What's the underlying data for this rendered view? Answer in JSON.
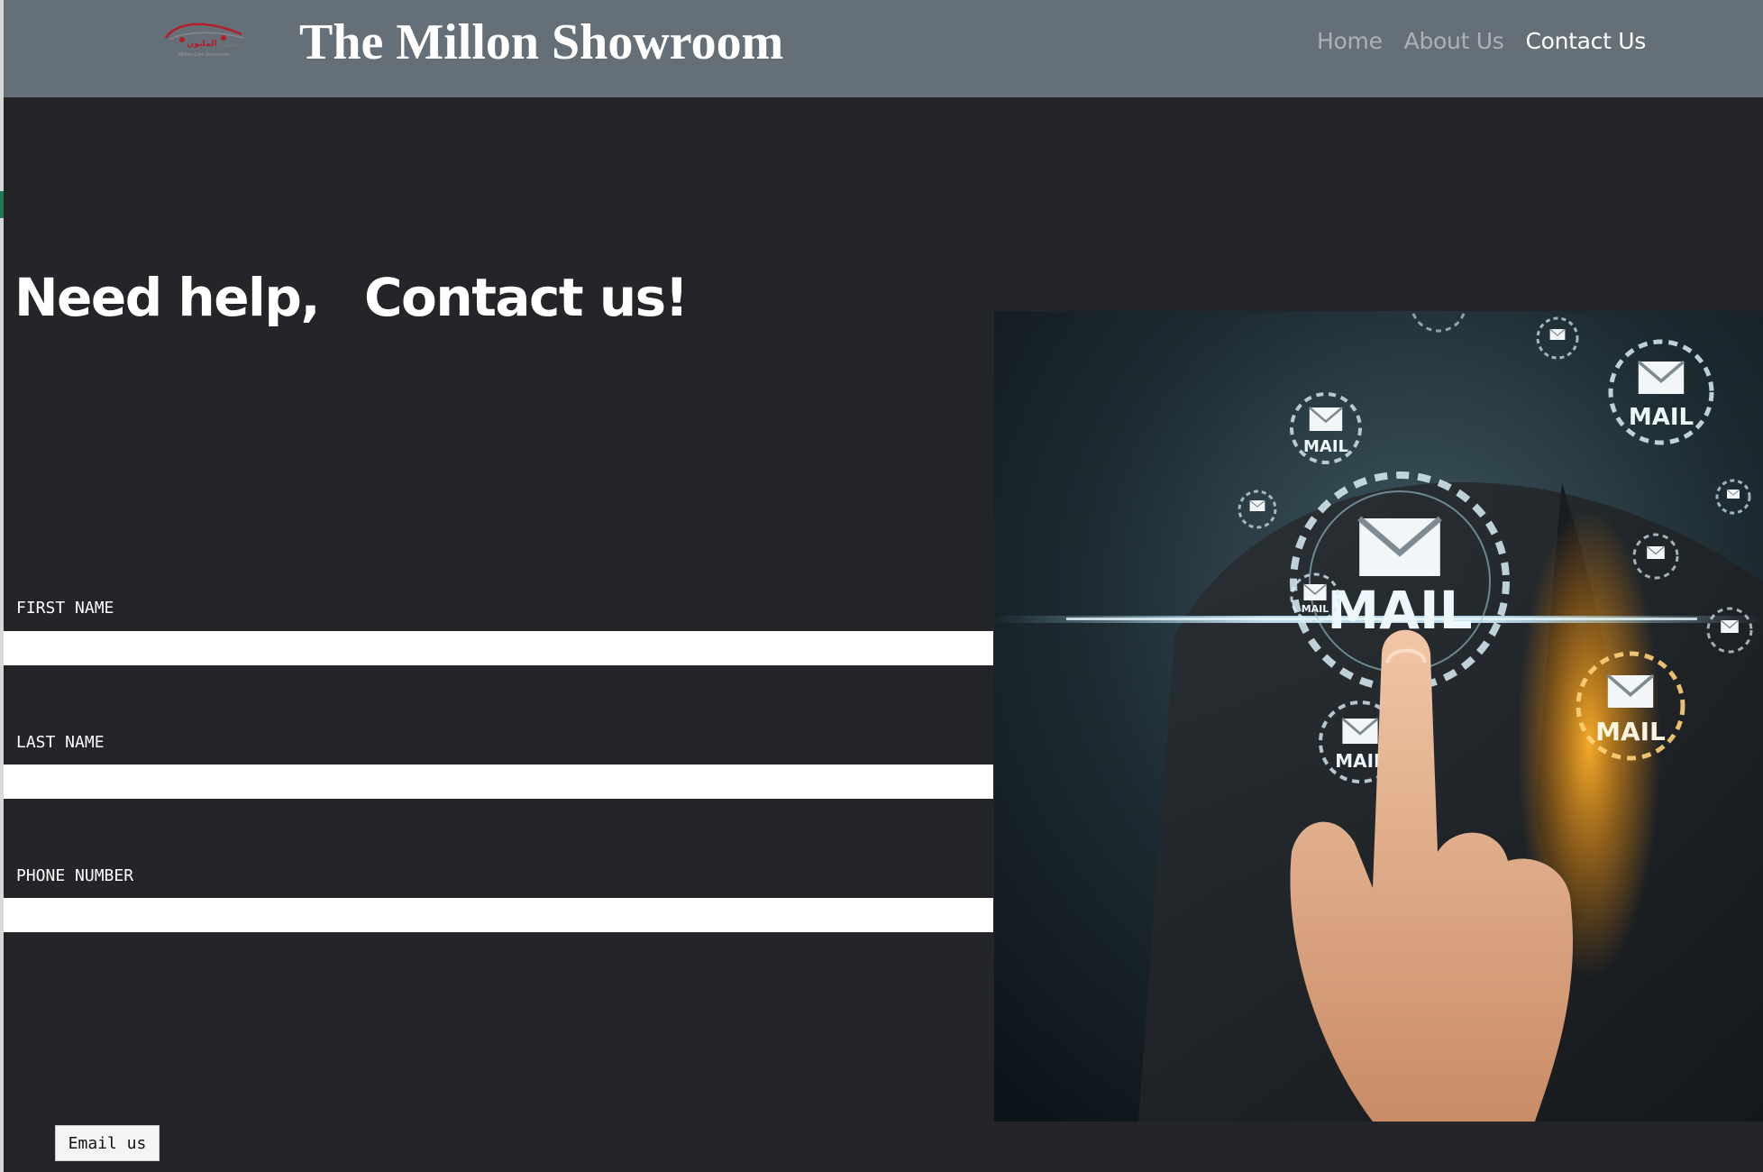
{
  "header": {
    "logo_alt": "شوروم المليون Million Cars Showroom",
    "title": "The Millon Showroom",
    "nav": [
      {
        "label": "Home",
        "active": false
      },
      {
        "label": "About Us",
        "active": false
      },
      {
        "label": "Contact Us",
        "active": true
      }
    ]
  },
  "main": {
    "heading_part1": "Need help,",
    "heading_part2": "Contact us!",
    "form": {
      "first_name_label": "FIRST NAME",
      "first_name_value": "",
      "last_name_label": "LAST NAME",
      "last_name_value": "",
      "phone_label": "PHONE NUMBER",
      "phone_value": "",
      "submit_label": "Email us"
    },
    "image": {
      "icon_text": "MAIL"
    }
  },
  "colors": {
    "background": "#232529",
    "navbar": "#656f78",
    "nav_inactive": "#aab2b9",
    "nav_active": "#ffffff",
    "accent_orange": "#f39a1a"
  }
}
